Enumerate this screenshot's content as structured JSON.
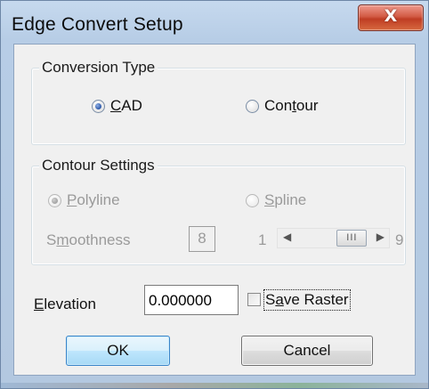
{
  "window": {
    "title": "Edge Convert Setup",
    "close_icon": "close-icon",
    "close_glyph": "X"
  },
  "conversion_type": {
    "legend": "Conversion Type",
    "options": [
      {
        "label_pre": "",
        "label_key": "C",
        "label_post": "AD",
        "checked": true
      },
      {
        "label_pre": "Con",
        "label_key": "t",
        "label_post": "our",
        "checked": false
      }
    ]
  },
  "contour_settings": {
    "legend": "Contour Settings",
    "options": [
      {
        "label_pre": "",
        "label_key": "P",
        "label_post": "olyline",
        "checked": true,
        "enabled": false
      },
      {
        "label_pre": "",
        "label_key": "S",
        "label_post": "pline",
        "checked": false,
        "enabled": false
      }
    ],
    "smoothness": {
      "label_pre": "S",
      "label_key": "m",
      "label_post": "oothness",
      "value": "8",
      "min_label": "1",
      "max_label": "9",
      "left_arrow": "◀",
      "right_arrow": "▶",
      "thumb_grip": "III",
      "level": 8
    }
  },
  "elevation": {
    "label_key": "E",
    "label_post": "levation",
    "value": "0.000000"
  },
  "save_raster": {
    "label_pre": "S",
    "label_key": "a",
    "label_post": "ve Raster",
    "checked": false
  },
  "buttons": {
    "ok": "OK",
    "cancel": "Cancel"
  },
  "colors": {
    "ok_border": "#3a85c9",
    "close_red": "#c9482f",
    "disabled_text": "#9a9a9a"
  }
}
